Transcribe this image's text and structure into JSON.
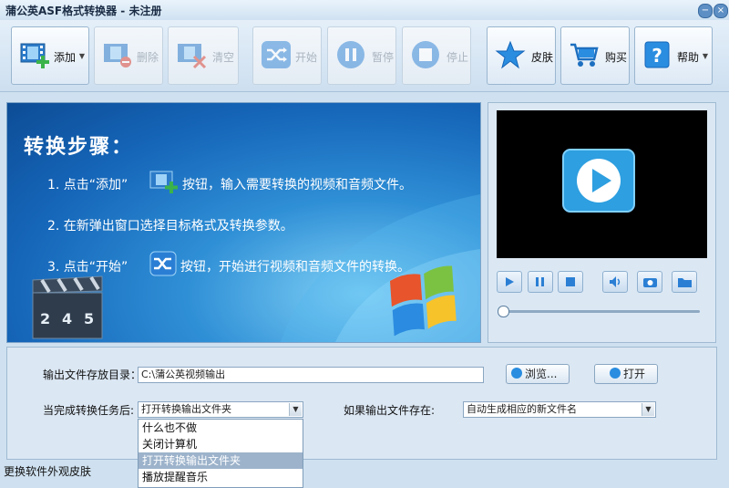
{
  "window": {
    "title": "蒲公英ASF格式转换器 - 未注册",
    "minimize_glyph": "−",
    "close_glyph": "×"
  },
  "toolbar": {
    "add": {
      "label": "添加",
      "icon": "film-add-icon",
      "enabled": true
    },
    "delete": {
      "label": "删除",
      "icon": "film-remove-icon",
      "enabled": false
    },
    "clear": {
      "label": "清空",
      "icon": "film-clear-icon",
      "enabled": false
    },
    "start": {
      "label": "开始",
      "icon": "shuffle-icon",
      "enabled": false
    },
    "pause": {
      "label": "暂停",
      "icon": "pause-icon",
      "enabled": false
    },
    "stop": {
      "label": "停止",
      "icon": "stop-icon",
      "enabled": false
    },
    "skin": {
      "label": "皮肤",
      "icon": "star-icon",
      "enabled": true
    },
    "buy": {
      "label": "购买",
      "icon": "cart-icon",
      "enabled": true
    },
    "help": {
      "label": "帮助",
      "icon": "help-icon",
      "enabled": true
    },
    "dropdown_glyph": "▼"
  },
  "banner": {
    "heading": "转换步骤：",
    "step1_a": "1. 点击“添加”",
    "step1_b": "按钮，输入需要转换的视频和音频文件。",
    "step2": "2. 在新弹出窗口选择目标格式及转换参数。",
    "step3_a": "3. 点击“开始”",
    "step3_b": "按钮，开始进行视频和音频文件的转换。",
    "clapper_digits": [
      "2",
      "4",
      "5"
    ]
  },
  "player": {
    "buttons": [
      "play-icon",
      "pause-icon",
      "stop-icon",
      "volume-icon",
      "snapshot-icon",
      "folder-icon"
    ],
    "progress": 0
  },
  "settings": {
    "output_dir_label": "输出文件存放目录：",
    "output_dir_value": "C:\\蒲公英视频输出",
    "browse_label": "浏览...",
    "open_label": "打开",
    "after_task_label": "当完成转换任务后:",
    "after_task_value": "打开转换输出文件夹",
    "exists_label": "如果输出文件存在:",
    "exists_value": "自动生成相应的新文件名",
    "after_task_options": [
      "什么也不做",
      "关闭计算机",
      "打开转换输出文件夹",
      "播放提醒音乐"
    ],
    "selected_option_index": 2
  },
  "status": {
    "text": "更换软件外观皮肤"
  },
  "colors": {
    "accent": "#2a7fd4",
    "play_tile": "#2e9fe0",
    "add_green": "#3bb34a",
    "remove_red": "#d9463a"
  }
}
